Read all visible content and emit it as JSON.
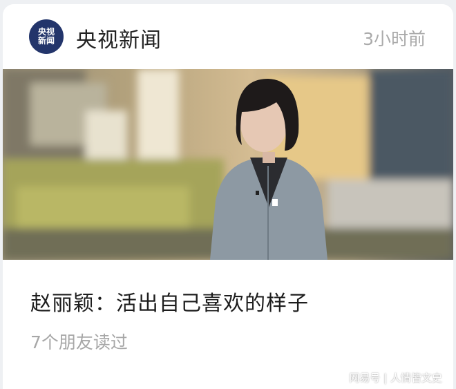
{
  "card": {
    "logo_line1": "央视",
    "logo_line2": "新闻",
    "source": "央视新闻",
    "time": "3小时前"
  },
  "article": {
    "title": "赵丽颖：活出自己喜欢的样子",
    "readers": "7个朋友读过"
  },
  "watermark": "网易号 | 人情皆文史",
  "colors": {
    "logo_bg": "#23356b",
    "title": "#1d1d1d",
    "secondary": "#a7a7a7"
  },
  "icons": [
    "cctv-news-logo-icon"
  ]
}
